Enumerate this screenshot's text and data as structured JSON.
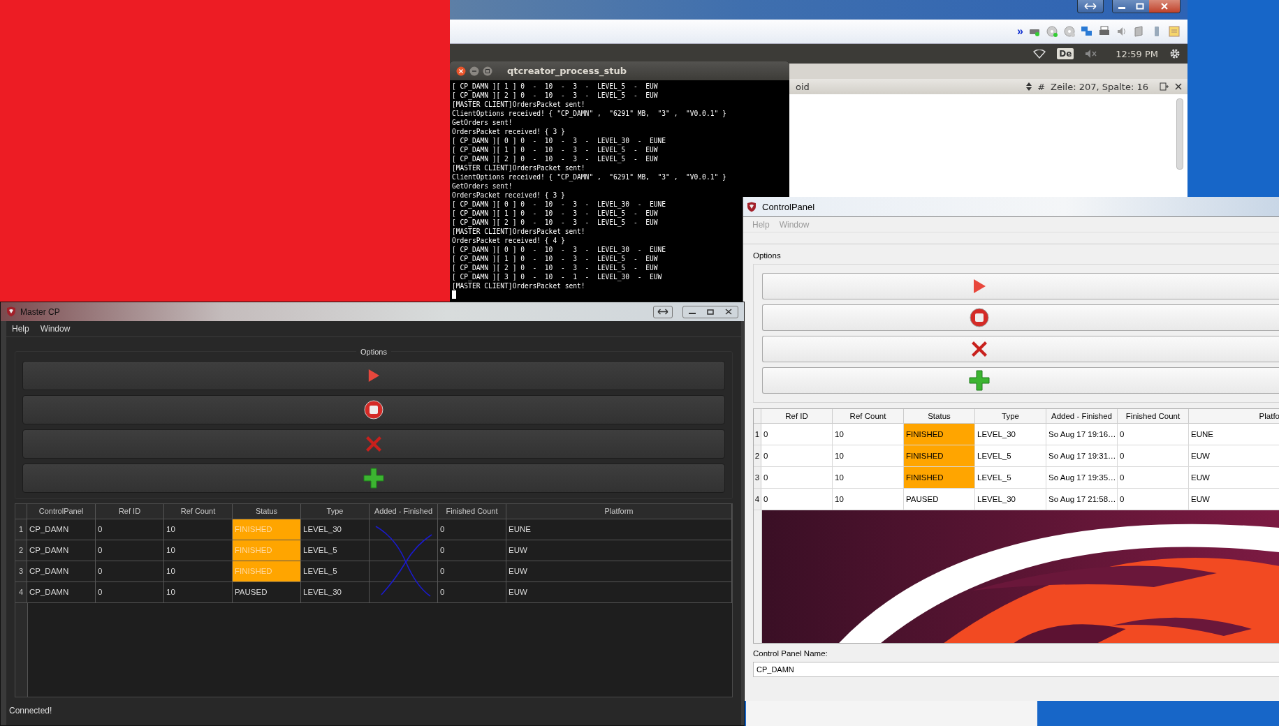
{
  "vm_window": {
    "toolbar_overflow": "»",
    "panel": {
      "keyboard_layout": "De",
      "clock": "12:59 PM"
    },
    "editor_bar": {
      "file": "oid",
      "hash": "#",
      "position": "Zeile: 207, Spalte: 16"
    }
  },
  "terminal": {
    "title": "qtcreator_process_stub",
    "lines": [
      "[ CP_DAMN ][ 1 ] 0  -  10  -  3  -  LEVEL_5  -  EUW",
      "[ CP_DAMN ][ 2 ] 0  -  10  -  3  -  LEVEL_5  -  EUW",
      "[MASTER CLIENT]OrdersPacket sent!",
      "ClientOptions received! { \"CP_DAMN\" ,  \"6291\" MB,  \"3\" ,  \"V0.0.1\" }",
      "GetOrders sent!",
      "OrdersPacket received! { 3 }",
      "[ CP_DAMN ][ 0 ] 0  -  10  -  3  -  LEVEL_30  -  EUNE",
      "[ CP_DAMN ][ 1 ] 0  -  10  -  3  -  LEVEL_5  -  EUW",
      "[ CP_DAMN ][ 2 ] 0  -  10  -  3  -  LEVEL_5  -  EUW",
      "[MASTER CLIENT]OrdersPacket sent!",
      "ClientOptions received! { \"CP_DAMN\" ,  \"6291\" MB,  \"3\" ,  \"V0.0.1\" }",
      "GetOrders sent!",
      "OrdersPacket received! { 3 }",
      "[ CP_DAMN ][ 0 ] 0  -  10  -  3  -  LEVEL_30  -  EUNE",
      "[ CP_DAMN ][ 1 ] 0  -  10  -  3  -  LEVEL_5  -  EUW",
      "[ CP_DAMN ][ 2 ] 0  -  10  -  3  -  LEVEL_5  -  EUW",
      "[MASTER CLIENT]OrdersPacket sent!",
      "OrdersPacket received! { 4 }",
      "[ CP_DAMN ][ 0 ] 0  -  10  -  3  -  LEVEL_30  -  EUNE",
      "[ CP_DAMN ][ 1 ] 0  -  10  -  3  -  LEVEL_5  -  EUW",
      "[ CP_DAMN ][ 2 ] 0  -  10  -  3  -  LEVEL_5  -  EUW",
      "[ CP_DAMN ][ 3 ] 0  -  10  -  1  -  LEVEL_30  -  EUW",
      "[MASTER CLIENT]OrdersPacket sent!"
    ]
  },
  "control_panel_window": {
    "title": "ControlPanel",
    "menu": [
      "Help",
      "Window"
    ],
    "options_label": "Options",
    "option_buttons": [
      {
        "kind": "play"
      },
      {
        "kind": "stop"
      },
      {
        "kind": "remove"
      },
      {
        "kind": "add"
      }
    ],
    "table": {
      "columns": [
        "Ref ID",
        "Ref Count",
        "Status",
        "Type",
        "Added - Finished",
        "Finished Count",
        "Platfo"
      ],
      "rows": [
        {
          "number": "1",
          "ref_id": "0",
          "ref_count": "10",
          "status": "FINISHED",
          "highlighted": true,
          "type": "LEVEL_30",
          "added": "So Aug 17 19:16…",
          "finished_count": "0",
          "platform": "EUNE"
        },
        {
          "number": "2",
          "ref_id": "0",
          "ref_count": "10",
          "status": "FINISHED",
          "highlighted": true,
          "type": "LEVEL_5",
          "added": "So Aug 17 19:31…",
          "finished_count": "0",
          "platform": "EUW"
        },
        {
          "number": "3",
          "ref_id": "0",
          "ref_count": "10",
          "status": "FINISHED",
          "highlighted": true,
          "type": "LEVEL_5",
          "added": "So Aug 17 19:35…",
          "finished_count": "0",
          "platform": "EUW"
        },
        {
          "number": "4",
          "ref_id": "0",
          "ref_count": "10",
          "status": "PAUSED",
          "highlighted": false,
          "type": "LEVEL_30",
          "added": "So Aug 17 21:58…",
          "finished_count": "0",
          "platform": "EUW"
        }
      ]
    },
    "name_label": "Control Panel Name:",
    "name_value": "CP_DAMN"
  },
  "master_window": {
    "title": "Master CP",
    "menu": [
      "Help",
      "Window"
    ],
    "options_label": "Options",
    "option_buttons": [
      {
        "kind": "play"
      },
      {
        "kind": "stop"
      },
      {
        "kind": "remove"
      },
      {
        "kind": "add"
      }
    ],
    "table": {
      "columns": [
        "ControlPanel",
        "Ref ID",
        "Ref Count",
        "Status",
        "Type",
        "Added - Finished",
        "Finished Count",
        "Platform"
      ],
      "rows": [
        {
          "number": "1",
          "control_panel": "CP_DAMN",
          "ref_id": "0",
          "ref_count": "10",
          "status": "FINISHED",
          "highlighted": true,
          "type": "LEVEL_30",
          "finished_count": "0",
          "platform": "EUNE"
        },
        {
          "number": "2",
          "control_panel": "CP_DAMN",
          "ref_id": "0",
          "ref_count": "10",
          "status": "FINISHED",
          "highlighted": true,
          "type": "LEVEL_5",
          "finished_count": "0",
          "platform": "EUW"
        },
        {
          "number": "3",
          "control_panel": "CP_DAMN",
          "ref_id": "0",
          "ref_count": "10",
          "status": "FINISHED",
          "highlighted": true,
          "type": "LEVEL_5",
          "finished_count": "0",
          "platform": "EUW"
        },
        {
          "number": "4",
          "control_panel": "CP_DAMN",
          "ref_id": "0",
          "ref_count": "10",
          "status": "PAUSED",
          "highlighted": false,
          "type": "LEVEL_30",
          "finished_count": "0",
          "platform": "EUW"
        }
      ]
    },
    "status_bar": "Connected!"
  }
}
